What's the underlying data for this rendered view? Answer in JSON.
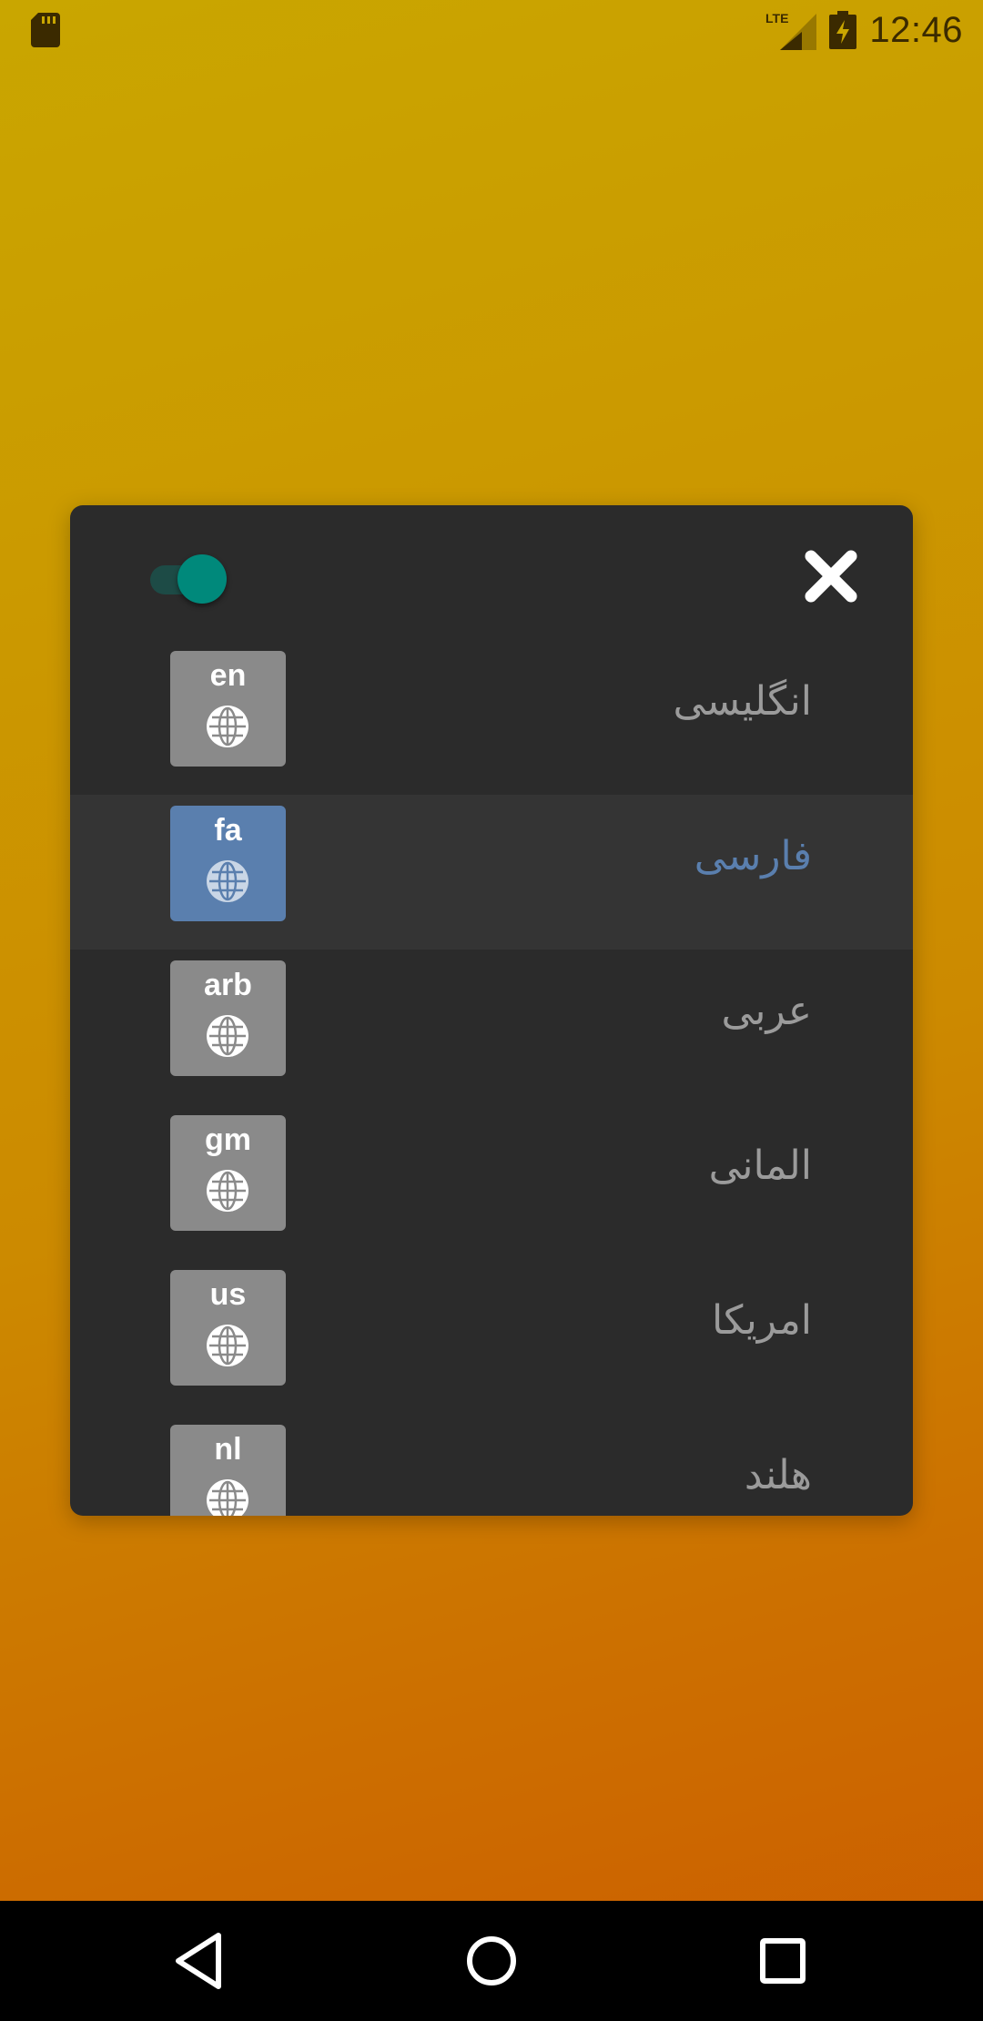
{
  "status_bar": {
    "time": "12:46",
    "network_label": "LTE",
    "icons": [
      "sd-card-icon",
      "lte-signal-icon",
      "battery-charging-icon"
    ]
  },
  "dialog": {
    "toggle": {
      "state": "on",
      "accent_color": "#00897b"
    },
    "close_icon": "close-icon",
    "languages": [
      {
        "code": "en",
        "name": "انگلیسی",
        "selected": false
      },
      {
        "code": "fa",
        "name": "فارسی",
        "selected": true
      },
      {
        "code": "arb",
        "name": "عربی",
        "selected": false
      },
      {
        "code": "gm",
        "name": "المانی",
        "selected": false
      },
      {
        "code": "us",
        "name": "امریکا",
        "selected": false
      },
      {
        "code": "nl",
        "name": "هلند",
        "selected": false
      }
    ]
  },
  "nav_bar": {
    "icons": [
      "back-icon",
      "home-icon",
      "recents-icon"
    ]
  },
  "colors": {
    "dialog_bg": "#2b2b2b",
    "selected_accent": "#5a7fae",
    "tile_default": "#8a8a8a",
    "toggle_accent": "#00897b"
  }
}
